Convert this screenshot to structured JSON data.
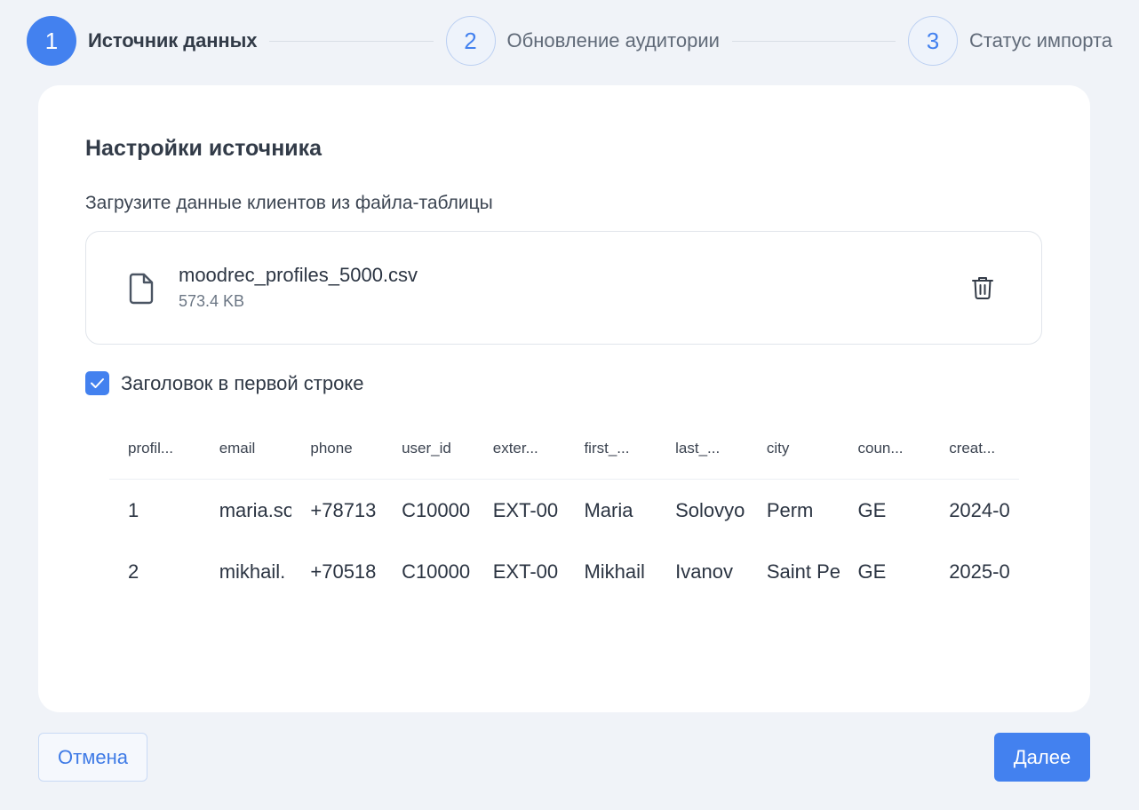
{
  "stepper": {
    "steps": [
      {
        "number": "1",
        "label": "Источник данных",
        "state": "active"
      },
      {
        "number": "2",
        "label": "Обновление аудитории",
        "state": "inactive"
      },
      {
        "number": "3",
        "label": "Статус импорта",
        "state": "inactive"
      }
    ]
  },
  "source": {
    "title": "Настройки источника",
    "subtitle": "Загрузите данные клиентов из файла-таблицы",
    "file": {
      "icon": "file-icon",
      "name": "moodrec_profiles_5000.csv",
      "size": "573.4 KB",
      "delete_icon": "trash-icon"
    },
    "header_checkbox": {
      "label": "Заголовок в первой строке",
      "checked": true
    }
  },
  "preview": {
    "columns": [
      "profil...",
      "email",
      "phone",
      "user_id",
      "exter...",
      "first_...",
      "last_...",
      "city",
      "coun...",
      "creat..."
    ],
    "rows": [
      [
        "1",
        "maria.so",
        "+78713",
        "C10000",
        "EXT-00",
        "Maria",
        "Solovyo",
        "Perm",
        "GE",
        "2024-0"
      ],
      [
        "2",
        "mikhail.",
        "+70518",
        "C10000",
        "EXT-00",
        "Mikhail",
        "Ivanov",
        "Saint Pe",
        "GE",
        "2025-0"
      ]
    ]
  },
  "footer": {
    "cancel_label": "Отмена",
    "next_label": "Далее"
  },
  "colors": {
    "accent": "#4381ef",
    "background": "#f0f3f8",
    "card": "#ffffff"
  }
}
